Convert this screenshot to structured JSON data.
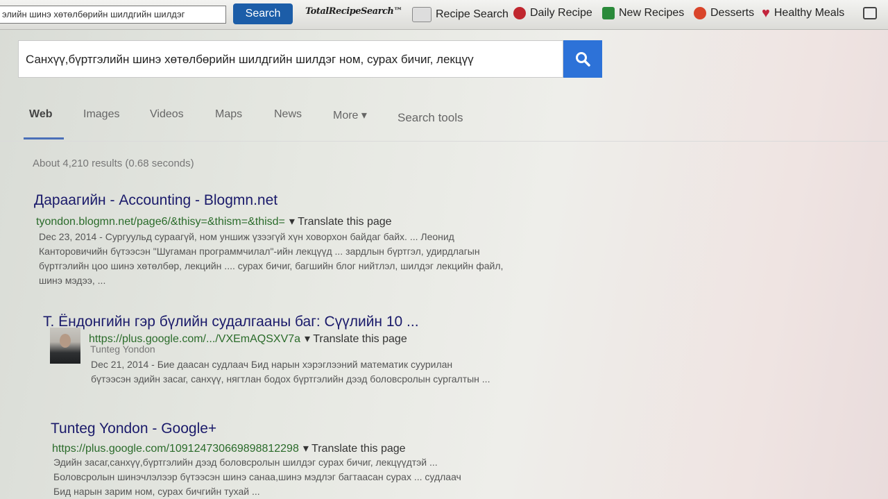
{
  "toolbar": {
    "search_value": "элийн шинэ хөтөлбөрийн шилдгийн шилдэг",
    "search_button": "Search",
    "brand": "TotalRecipeSearch™",
    "links": [
      {
        "label": "Recipe Search",
        "icon": "notepad-icon",
        "color": "#888888"
      },
      {
        "label": "Daily Recipe",
        "icon": "daily-badge-icon",
        "color": "#c0262e"
      },
      {
        "label": "New Recipes",
        "icon": "new-badge-icon",
        "color": "#2a8a3a"
      },
      {
        "label": "Desserts",
        "icon": "dessert-icon",
        "color": "#d9442a"
      },
      {
        "label": "Healthy Meals",
        "icon": "heart-icon",
        "color": "#c2243c"
      }
    ]
  },
  "search": {
    "query": "Санхүү,бүртгэлийн шинэ хөтөлбөрийн шилдгийн шилдэг ном, сурах бичиг, лекцүү",
    "button_icon": "magnifier-icon"
  },
  "tabs": [
    {
      "label": "Web",
      "active": true
    },
    {
      "label": "Images"
    },
    {
      "label": "Videos"
    },
    {
      "label": "Maps"
    },
    {
      "label": "News"
    },
    {
      "label": "More ▾"
    },
    {
      "label": "Search tools"
    }
  ],
  "stats": "About 4,210 results (0.68 seconds)",
  "results": [
    {
      "title": "Дараагийн - Accounting - Blogmn.net",
      "url": "tyondon.blogmn.net/page6/&thisy=&thism=&thisd=",
      "translate": "▾ Translate this page",
      "snippet": "Dec 23, 2014 - Сургуульд сураагүй, ном уншиж үзээгүй хүн ховорхон байдаг байх. ... Леонид Канторовичийн бүтээсэн \"Шугаман программчилал\"-ийн лекцүүд ... зардлын бүртгэл, удирдлагын бүртгэлийн цоо шинэ хөтөлбөр, лекцийн .... сурах бичиг, багшийн блог нийтлэл, шилдэг лекцийн файл, шинэ мэдээ, ..."
    },
    {
      "title": "Т. Ёндонгийн гэр бүлийн судалгааны баг: Сүүлийн 10 ...",
      "url": "https://plus.google.com/.../VXEmAQSXV7a",
      "translate": "▾ Translate this page",
      "author": "Tunteg Yondon",
      "snippet": "Dec 21, 2014 - Бие даасан судлаач Бид нарын хэрэглээний математик суурилан бүтээсэн эдийн засаг, санхүү, нягтлан бодох бүртгэлийн дээд боловсролын сургалтын ..."
    },
    {
      "title": "Tunteg Yondon - Google+",
      "url": "https://plus.google.com/109124730669898812298",
      "translate": "▾ Translate this page",
      "snippet": "Эдийн засаг,санхүү,бүртгэлийн дээд боловсролын шилдэг сурах бичиг, лекцүүдтэй ... Боловсролын шинэчлэлээр бүтээсэн шинэ санаа,шинэ мэдлэг багтаасан сурах ... судлаач Бид нарын зарим ном, сурах бичгийн тухай ..."
    }
  ]
}
